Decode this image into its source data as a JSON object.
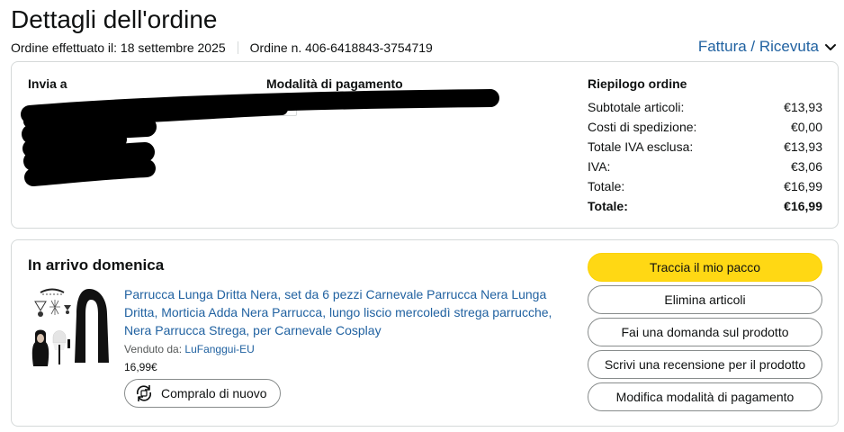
{
  "page_title": "Dettagli dell'ordine",
  "order_date": "Ordine effettuato il: 18 settembre 2025",
  "order_number": "Ordine n. 406-6418843-3754719",
  "invoice_link": "Fattura / Ricevuta",
  "shipping": {
    "heading": "Invia a"
  },
  "payment": {
    "heading": "Modalità di pagamento"
  },
  "summary": {
    "heading": "Riepilogo ordine",
    "rows": [
      {
        "label": "Subtotale articoli:",
        "value": "€13,93"
      },
      {
        "label": "Costi di spedizione:",
        "value": "€0,00"
      },
      {
        "label": "Totale IVA esclusa:",
        "value": "€13,93"
      },
      {
        "label": "IVA:",
        "value": "€3,06"
      },
      {
        "label": "Totale:",
        "value": "€16,99"
      },
      {
        "label": "Totale:",
        "value": "€16,99"
      }
    ]
  },
  "shipment": {
    "status": "In arrivo domenica",
    "product_title": "Parrucca Lunga Dritta Nera, set da 6 pezzi Carnevale Parrucca Nera Lunga Dritta, Morticia Adda Nera Parrucca, lungo liscio mercoledì strega parrucche, Nera Parrucca Strega, per Carnevale Cosplay",
    "sold_by_label": "Venduto da:",
    "seller": "LuFanggui-EU",
    "price": "16,99€",
    "rebuy_label": "Compralo di nuovo"
  },
  "actions": {
    "track": "Traccia il mio pacco",
    "delete": "Elimina articoli",
    "question": "Fai una domanda sul prodotto",
    "review": "Scrivi una recensione per il prodotto",
    "edit_payment": "Modifica modalità di pagamento"
  },
  "colors": {
    "link": "#2162a1",
    "primary_button": "#ffd814",
    "border": "#d5d9d9"
  }
}
